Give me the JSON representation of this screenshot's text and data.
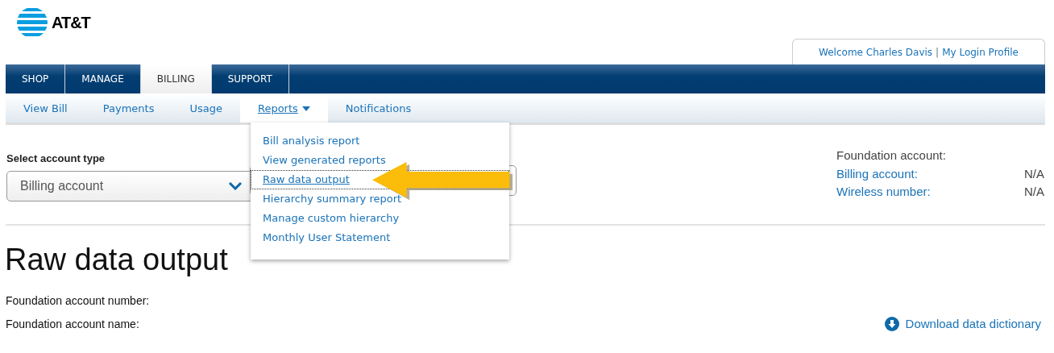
{
  "logo": {
    "text": "AT&T"
  },
  "welcome": {
    "greeting": "Welcome Charles Davis",
    "separator": "|",
    "profile_link": "My Login Profile"
  },
  "main_tabs": [
    {
      "label": "SHOP",
      "selected": false
    },
    {
      "label": "MANAGE",
      "selected": false
    },
    {
      "label": "BILLING",
      "selected": true
    },
    {
      "label": "SUPPORT",
      "selected": false
    }
  ],
  "sub_tabs": [
    {
      "label": "View Bill",
      "selected": false,
      "has_menu": false
    },
    {
      "label": "Payments",
      "selected": false,
      "has_menu": false
    },
    {
      "label": "Usage",
      "selected": false,
      "has_menu": false
    },
    {
      "label": "Reports",
      "selected": true,
      "has_menu": true
    },
    {
      "label": "Notifications",
      "selected": false,
      "has_menu": false
    }
  ],
  "reports_menu": [
    {
      "label": "Bill analysis report",
      "selected": false
    },
    {
      "label": "View generated reports",
      "selected": false
    },
    {
      "label": "Raw data output",
      "selected": true
    },
    {
      "label": "Hierarchy summary report",
      "selected": false
    },
    {
      "label": "Manage custom hierarchy",
      "selected": false
    },
    {
      "label": "Monthly User Statement",
      "selected": false
    }
  ],
  "account_select": {
    "label": "Select account type",
    "value": "Billing account"
  },
  "account_info": [
    {
      "label": "Foundation account:",
      "kind": "plain"
    },
    {
      "label": "Billing account:",
      "value": "N/A",
      "kind": "link"
    },
    {
      "label": "Wireless number:",
      "value": "N/A",
      "kind": "link"
    }
  ],
  "page_title": "Raw data output",
  "fields": [
    "Foundation account number:",
    "Foundation account name:"
  ],
  "download_link": "Download data dictionary"
}
